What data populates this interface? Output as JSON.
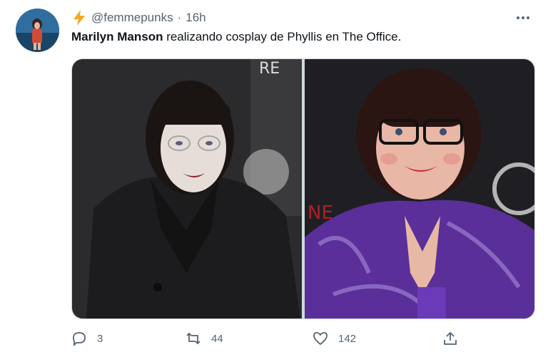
{
  "tweet": {
    "display_name": "Marilyn Manson",
    "handle": "@femmepunks",
    "separator": "·",
    "time": "16h",
    "text_rest": " realizando cosplay de Phyllis en The Office.",
    "more_icon": "more-dots-icon",
    "media": [
      {
        "description_icon": "photo-icon"
      },
      {
        "description_icon": "photo-icon"
      }
    ],
    "actions": {
      "reply_count": "3",
      "retweet_count": "44",
      "like_count": "142"
    }
  },
  "colors": {
    "text": "#0f1419",
    "secondary": "#536471",
    "border": "#cfd9de",
    "bolt": "#f5a623"
  }
}
